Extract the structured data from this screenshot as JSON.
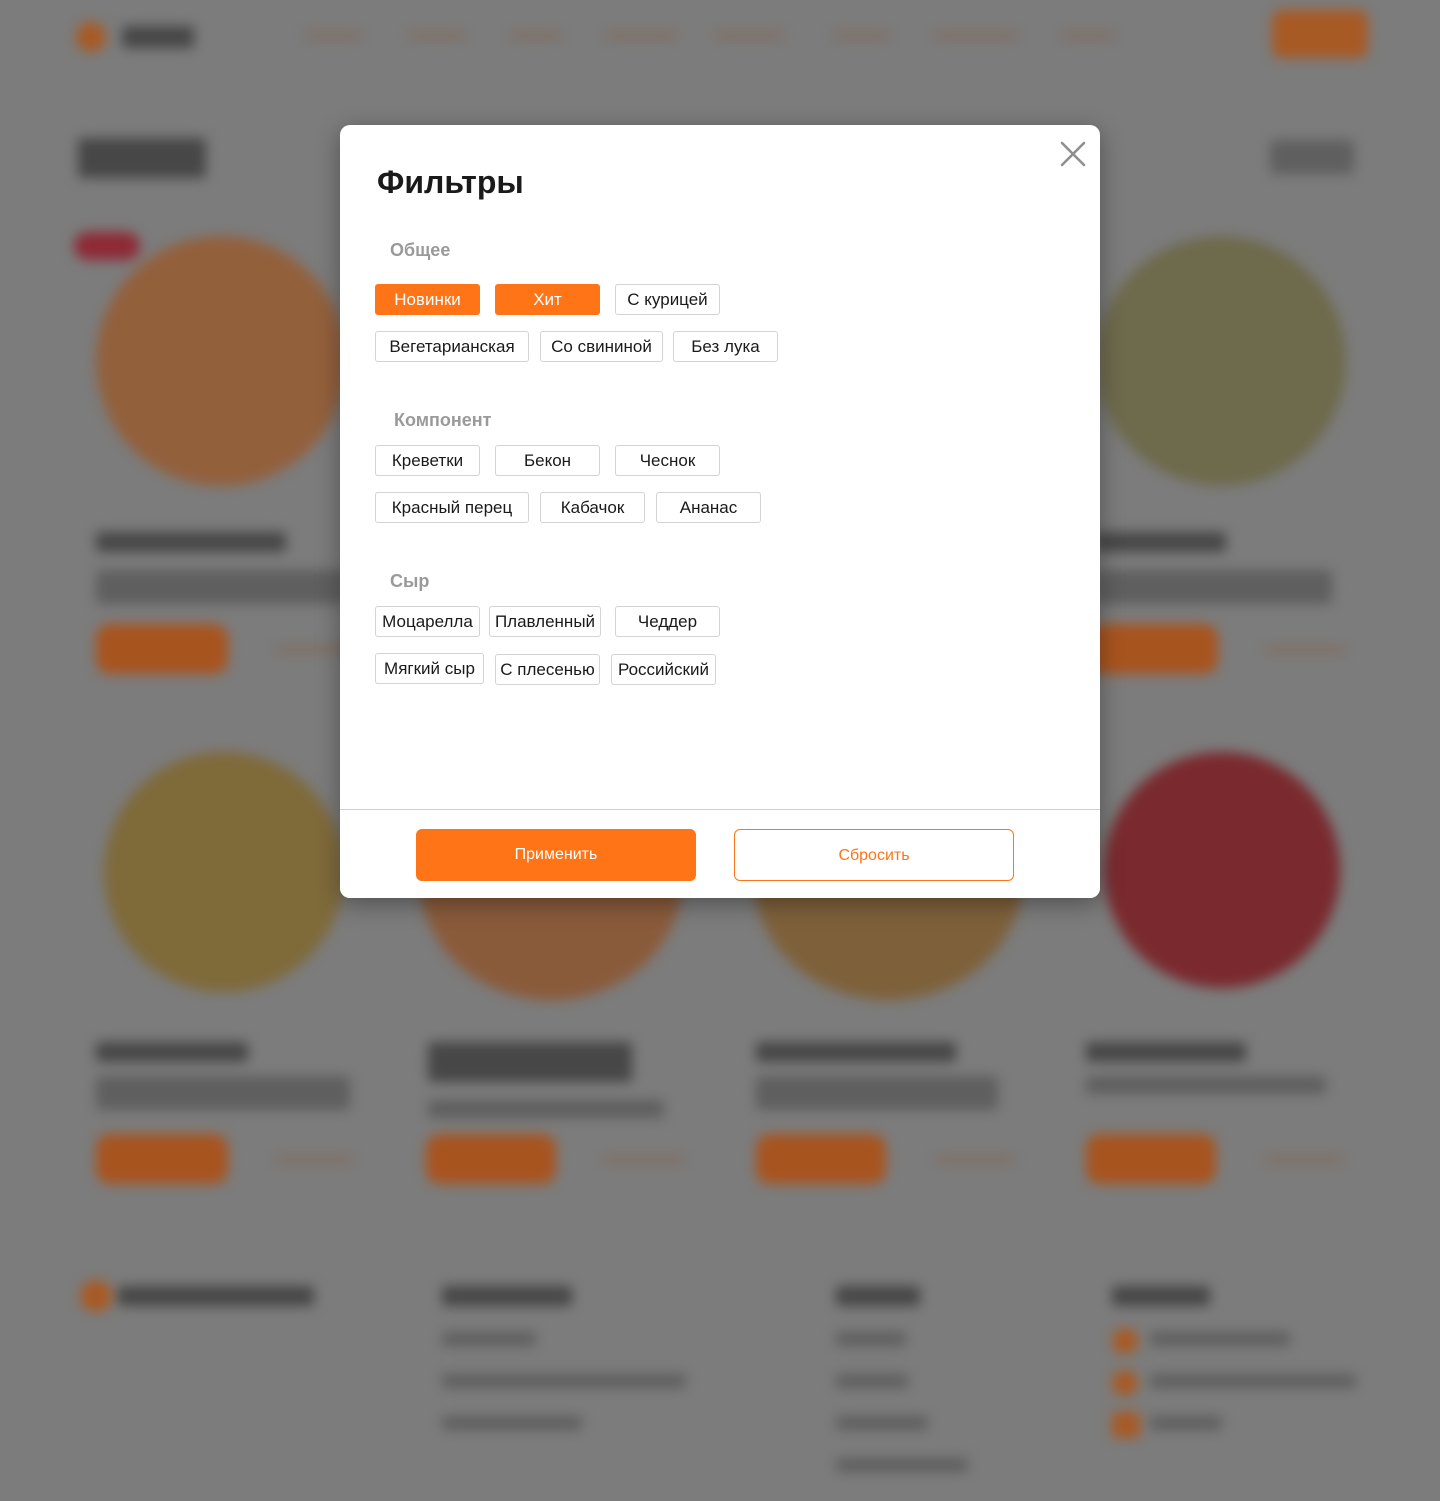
{
  "modal": {
    "title": "Фильтры",
    "sections": [
      {
        "title": "Общее",
        "chips": [
          {
            "label": "Новинки",
            "active": true
          },
          {
            "label": "Хит",
            "active": true
          },
          {
            "label": "С курицей",
            "active": false
          },
          {
            "label": "Вегетарианская",
            "active": false
          },
          {
            "label": "Со свининой",
            "active": false
          },
          {
            "label": "Без лука",
            "active": false
          }
        ]
      },
      {
        "title": "Компонент",
        "chips": [
          {
            "label": "Креветки",
            "active": false
          },
          {
            "label": "Бекон",
            "active": false
          },
          {
            "label": "Чеснок",
            "active": false
          },
          {
            "label": "Красный перец",
            "active": false
          },
          {
            "label": "Кабачок",
            "active": false
          },
          {
            "label": "Ананас",
            "active": false
          }
        ]
      },
      {
        "title": "Сыр",
        "chips": [
          {
            "label": "Моцарелла",
            "active": false
          },
          {
            "label": "Плавленный",
            "active": false
          },
          {
            "label": "Чеддер",
            "active": false
          },
          {
            "label": "Мягкий сыр",
            "active": false
          },
          {
            "label": "С плесенью",
            "active": false
          },
          {
            "label": "Российский",
            "active": false
          }
        ]
      }
    ],
    "apply_label": "Применить",
    "reset_label": "Сбросить",
    "close_icon": "close-icon"
  },
  "colors": {
    "accent": "#ff7417",
    "overlay": "#7c7c7c",
    "section_title": "#9a9a9a"
  }
}
